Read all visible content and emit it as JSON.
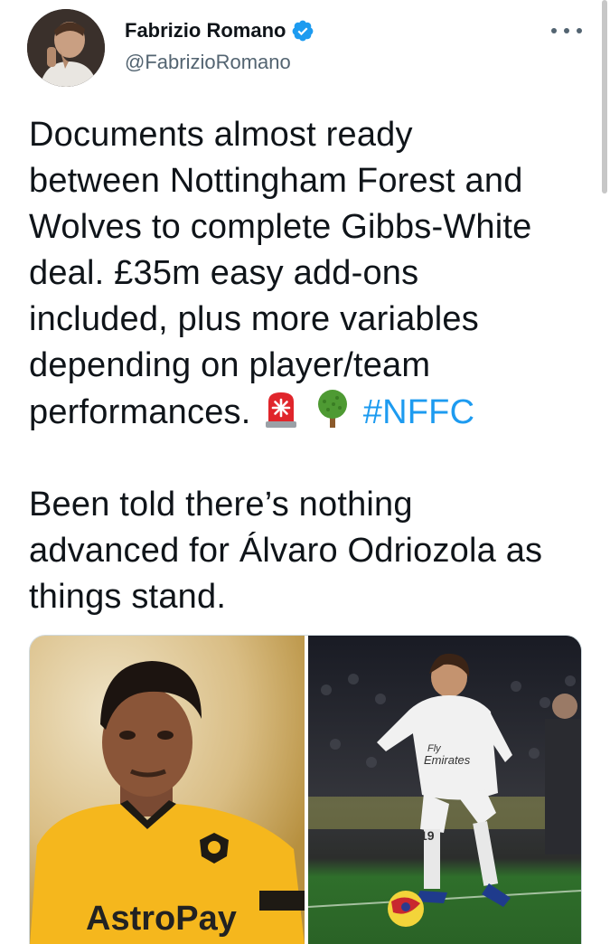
{
  "author": {
    "display_name": "Fabrizio Romano",
    "handle": "@FabrizioRomano",
    "verified": true
  },
  "icons": {
    "verified": "verified-badge-icon",
    "more": "more-options-icon",
    "emoji_1": "police-car-light-emoji",
    "emoji_2": "deciduous-tree-emoji"
  },
  "colors": {
    "text": "#0f1419",
    "secondary": "#536471",
    "accent": "#1d9bf0",
    "verified": "#1d9bf0"
  },
  "tweet": {
    "para1": {
      "line1": "Documents almost ready",
      "line2": "between Nottingham Forest and",
      "line3": "Wolves to complete Gibbs-White",
      "line4": "deal. £35m easy add-ons",
      "line5": "included, plus more variables",
      "line6": "depending on player/team",
      "line7": "performances.",
      "hashtag": "#NFFC"
    },
    "para2": {
      "line1": "Been told there’s nothing",
      "line2": "advanced for Álvaro Odriozola as",
      "line3": "things stand."
    }
  },
  "media": {
    "left_image": {
      "shirt_sponsor": "AstroPay"
    },
    "right_image": {
      "shirt_sponsor_line1": "Fly",
      "shirt_sponsor_line2": "Emirates",
      "shirt_number": "19"
    }
  }
}
